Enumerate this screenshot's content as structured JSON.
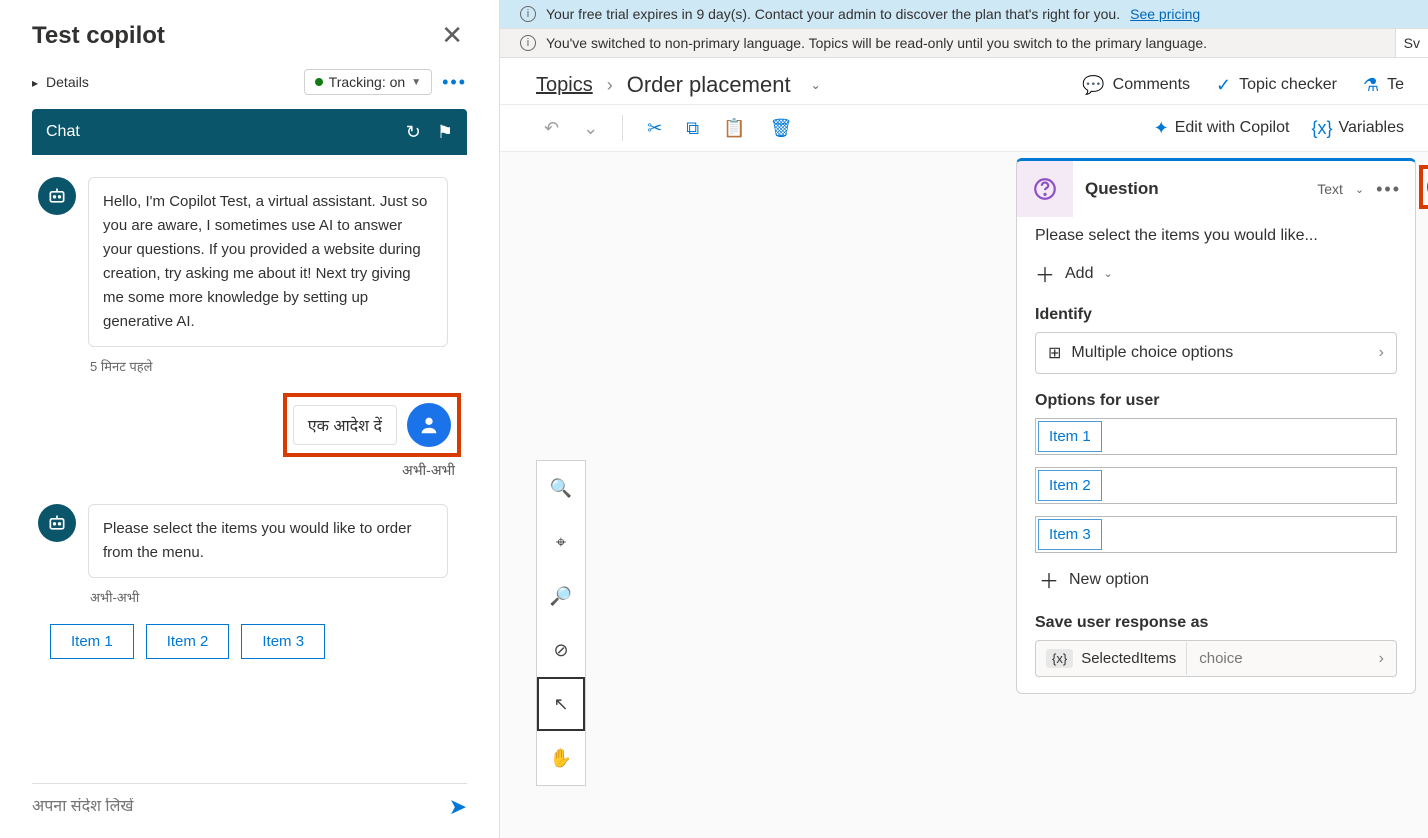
{
  "left": {
    "title": "Test copilot",
    "details": "Details",
    "tracking": "Tracking: on",
    "chat_label": "Chat",
    "bot_greeting": "Hello, I'm Copilot Test, a virtual assistant. Just so you are aware, I sometimes use AI to answer your questions. If you provided a website during creation, try asking me about it! Next try giving me some more knowledge by setting up generative AI.",
    "bot_greeting_time": "5 मिनट पहले",
    "user_msg": "एक आदेश दें",
    "user_time": "अभी-अभी",
    "bot_prompt": "Please select the items you would like to order from the menu.",
    "bot_prompt_time": "अभी-अभी",
    "options": [
      "Item 1",
      "Item 2",
      "Item 3"
    ],
    "input_placeholder": "अपना संदेश लिखें"
  },
  "banners": {
    "trial": "Your free trial expires in 9 day(s). Contact your admin to discover the plan that's right for you.",
    "see_pricing": "See pricing",
    "lang": "You've switched to non-primary language. Topics will be read-only until you switch to the primary language.",
    "switch_btn": "Sv"
  },
  "topic": {
    "breadcrumb": "Topics",
    "name": "Order placement",
    "actions": {
      "comments": "Comments",
      "checker": "Topic checker",
      "test": "Te"
    }
  },
  "toolbar": {
    "edit_copilot": "Edit with Copilot",
    "variables": "Variables"
  },
  "node": {
    "title": "Question",
    "type": "Text",
    "prompt": "Please select the items you would like...",
    "add": "Add",
    "identify_label": "Identify",
    "identify_value": "Multiple choice options",
    "options_label": "Options for user",
    "options": [
      "Item 1",
      "Item 2",
      "Item 3"
    ],
    "new_option": "New option",
    "save_label": "Save user response as",
    "var_name": "SelectedItems",
    "var_type": "choice"
  }
}
